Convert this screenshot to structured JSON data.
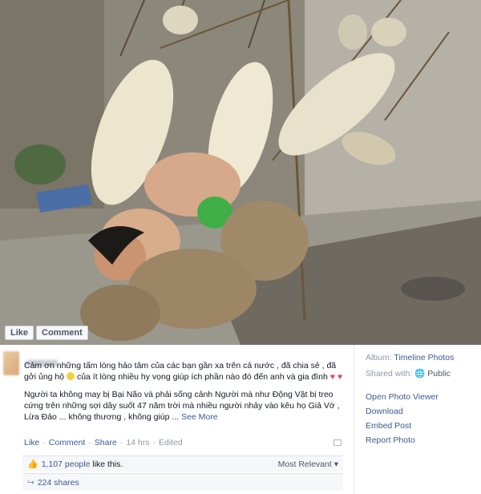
{
  "photo": {
    "like_label": "Like",
    "comment_label": "Comment"
  },
  "post": {
    "paragraph1": "Cảm ơn những tấm lòng hảo tâm của các bạn gần xa trên cả nước , đã chia sẻ , đã gởi ủng hộ",
    "paragraph1b": "của ít lòng nhiều hy vọng giúp ích phần nào đó đến anh và gia đình",
    "paragraph2": "Người ta không may bị Bại Não và phải sống cảnh Người mà như Động Vật bị treo cứng trên những sợi dây suốt 47 năm trời mà nhiều người nhảy vào kêu họ Giả Vờ , Lừa Đảo ... không thương , không giúp ...",
    "see_more": "See More",
    "actions": {
      "like": "Like",
      "comment": "Comment",
      "share": "Share",
      "time": "14 hrs",
      "edited": "Edited",
      "sep": "·"
    },
    "likes": {
      "count_text": "1,107 people",
      "suffix": "like this.",
      "sort": "Most Relevant"
    },
    "shares": "224 shares"
  },
  "side": {
    "album_label": "Album:",
    "album_value": "Timeline Photos",
    "shared_label": "Shared with:",
    "shared_value": "Public",
    "open_viewer": "Open Photo Viewer",
    "download": "Download",
    "embed": "Embed Post",
    "report": "Report Photo"
  },
  "colors": {
    "link": "#3b5998",
    "muted": "#9197a3"
  }
}
